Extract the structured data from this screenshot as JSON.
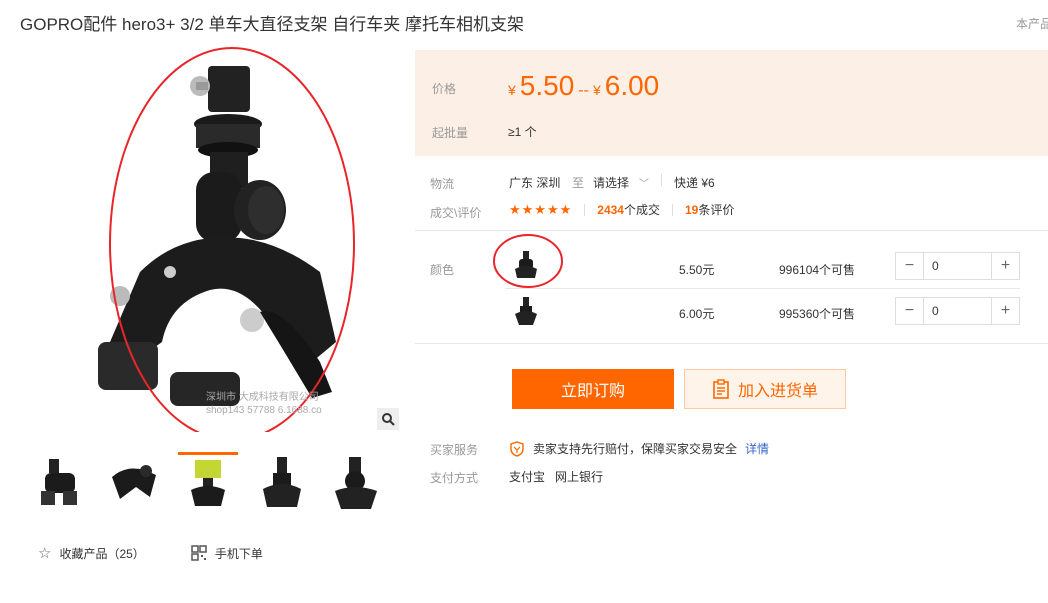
{
  "product": {
    "title": "GOPRO配件 hero3+ 3/2 单车大直径支架 自行车夹 摩托车相机支架",
    "corner_link": "本产品"
  },
  "gallery": {
    "watermark_line1": "深圳市 大成科技有限公司",
    "watermark_line2": "shop143 57788 6.1688.co",
    "thumb_count": 5,
    "active_thumb_index": 2,
    "favorite_label": "收藏产品（25）",
    "mobile_label": "手机下单"
  },
  "price": {
    "label": "价格",
    "currency": "¥",
    "low": "5.50",
    "sep": "--",
    "high": "6.00",
    "min_qty_label": "起批量",
    "min_qty": "≥1 个",
    "bg_color": "#fcefe5",
    "accent": "#ff6600"
  },
  "logistics": {
    "label": "物流",
    "origin": "广东 深圳",
    "to": "至",
    "dest": "请选择",
    "express": "快递 ¥6"
  },
  "deals": {
    "label": "成交\\评价",
    "stars": "★★★★★",
    "deal_count": "2434",
    "deal_suffix": "个成交",
    "review_count": "19",
    "review_suffix": "条评价"
  },
  "variants": {
    "label": "颜色",
    "rows": [
      {
        "price": "5.50元",
        "stock": "996104个可售",
        "qty": "0"
      },
      {
        "price": "6.00元",
        "stock": "995360个可售",
        "qty": "0"
      }
    ]
  },
  "actions": {
    "buy_now": "立即订购",
    "add_cart": "加入进货单"
  },
  "service": {
    "label": "买家服务",
    "text": "卖家支持先行赔付，保障买家交易安全",
    "detail_link": "详情"
  },
  "payment": {
    "label": "支付方式",
    "method1": "支付宝",
    "method2": "网上银行"
  }
}
